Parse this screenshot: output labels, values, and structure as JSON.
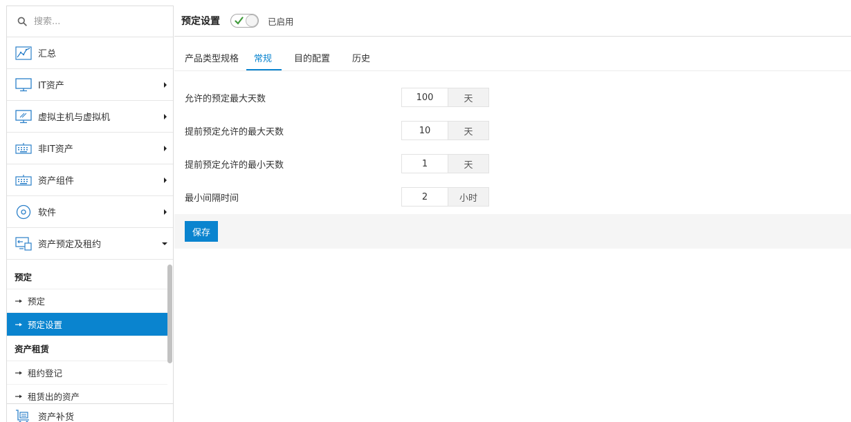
{
  "search": {
    "placeholder": "搜索..."
  },
  "sidebar": {
    "items": [
      {
        "label": "汇总"
      },
      {
        "label": "IT资产"
      },
      {
        "label": "虚拟主机与虚拟机"
      },
      {
        "label": "非IT资产"
      },
      {
        "label": "资产组件"
      },
      {
        "label": "软件"
      },
      {
        "label": "资产预定及租约"
      }
    ],
    "submenu": {
      "group1": "预定",
      "group1_items": [
        "预定",
        "预定设置"
      ],
      "group2": "资产租赁",
      "group2_items": [
        "租约登记",
        "租赁出的资产"
      ]
    },
    "bottom_item": "资产补货"
  },
  "header": {
    "title": "预定设置",
    "toggle_status": "已启用",
    "toggle_on": true
  },
  "tabs": [
    {
      "label": "产品类型规格"
    },
    {
      "label": "常规"
    },
    {
      "label": "目的配置"
    },
    {
      "label": "历史"
    }
  ],
  "form": {
    "rows": [
      {
        "label": "允许的预定最大天数",
        "value": "100",
        "unit": "天"
      },
      {
        "label": "提前预定允许的最大天数",
        "value": "10",
        "unit": "天"
      },
      {
        "label": "提前预定允许的最小天数",
        "value": "1",
        "unit": "天"
      },
      {
        "label": "最小间隔时间",
        "value": "2",
        "unit": "小时"
      }
    ],
    "save_label": "保存"
  },
  "colors": {
    "accent": "#0a84cf"
  }
}
